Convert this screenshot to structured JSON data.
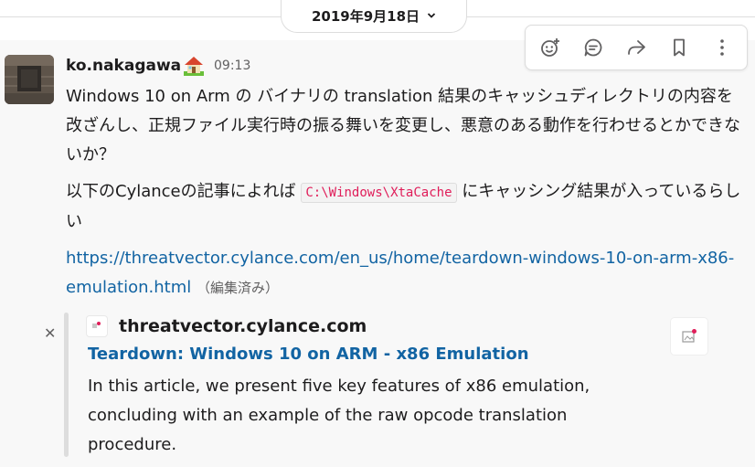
{
  "date_divider": {
    "label": "2019年9月18日"
  },
  "message": {
    "author": "ko.nakagawa",
    "time": "09:13",
    "paragraph1": "Windows 10 on Arm の バイナリの translation 結果のキャッシュディレクトリの内容を改ざんし、正規ファイル実行時の振る舞いを変更し、悪意のある動作を行わせるとかできないか？",
    "paragraph2_before": "以下のCylanceの記事によれば ",
    "code": "C:\\Windows\\XtaCache",
    "paragraph2_after": " にキャッシング結果が入っているらしい",
    "link": "https://threatvector.cylance.com/en_us/home/teardown-windows-10-on-arm-x86-emulation.html",
    "edited": "（編集済み）"
  },
  "unfurl": {
    "site": "threatvector.cylance.com",
    "title": "Teardown: Windows 10 on ARM - x86 Emulation",
    "description": "In this article, we present five key features of x86 emulation, concluding with an example of the raw opcode translation procedure."
  },
  "icons": {
    "date_chevron": "chevron-down-icon",
    "add_reaction": "add-reaction-icon",
    "reply_thread": "reply-thread-icon",
    "share": "share-icon",
    "bookmark": "bookmark-icon",
    "more": "more-vertical-icon",
    "close": "close-icon",
    "status_emoji": "house-emoji-icon"
  },
  "colors": {
    "link": "#1264a3",
    "code_text": "#e01e5a",
    "hover_bg": "#f8f8f8"
  }
}
